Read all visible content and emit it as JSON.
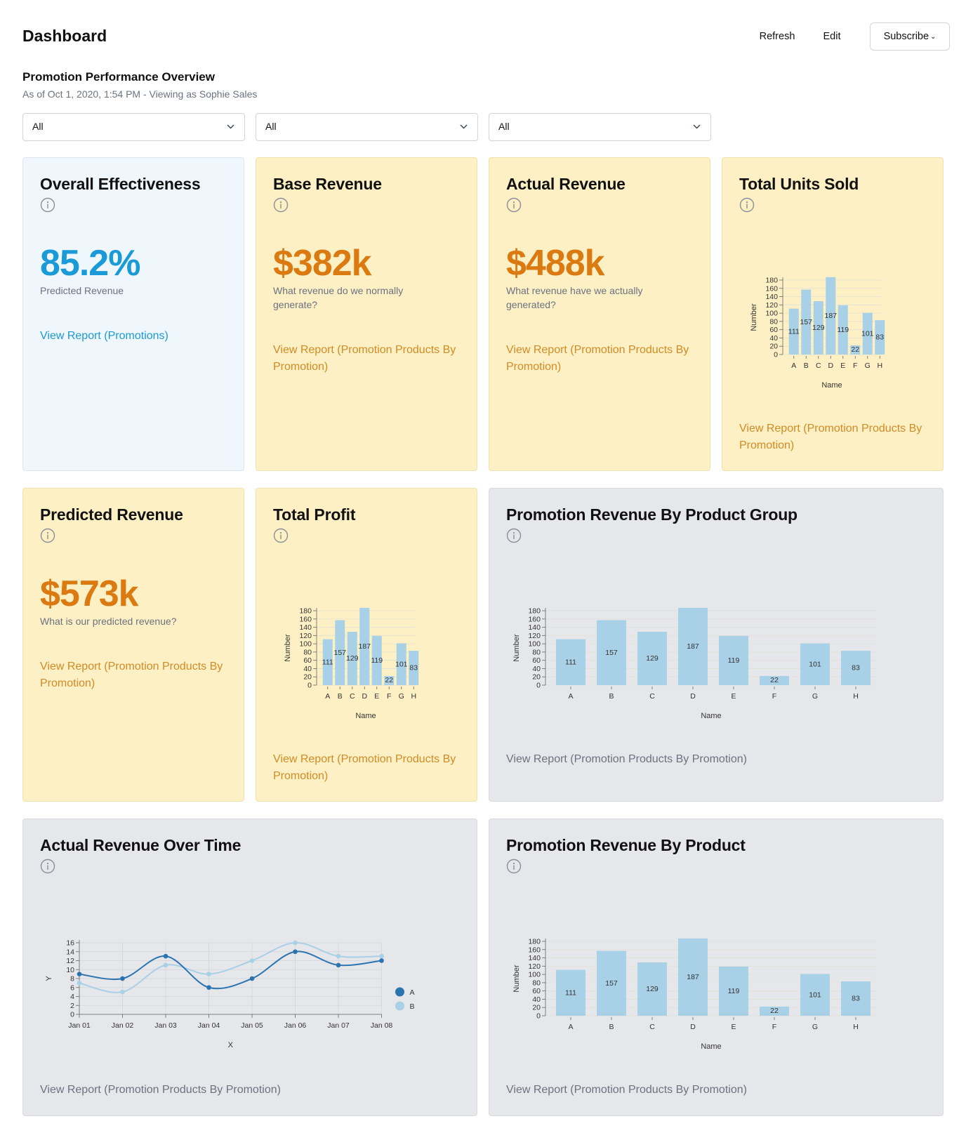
{
  "header": {
    "title": "Dashboard",
    "refresh_label": "Refresh",
    "edit_label": "Edit",
    "subscribe_label": "Subscribe"
  },
  "overview": {
    "title": "Promotion Performance Overview",
    "meta": "As of Oct 1, 2020, 1:54 PM - Viewing as Sophie Sales"
  },
  "filters": [
    {
      "value": "All"
    },
    {
      "value": "All"
    },
    {
      "value": "All"
    }
  ],
  "colors": {
    "card_blue": "#eff6fc",
    "card_yellow": "#fdf0c4",
    "card_gray": "#e6e7eb",
    "kpi_blue": "#1a9ad6",
    "kpi_orange": "#da7a11",
    "link_orange": "#d28b25",
    "bar": "#a8d0e6",
    "series_a": "#2c74b0",
    "series_b": "#a8d0e6"
  },
  "cards": {
    "overall_effectiveness": {
      "title": "Overall Effectiveness",
      "value": "85.2%",
      "desc": "Predicted Revenue",
      "link": "View Report (Promotions)"
    },
    "base_revenue": {
      "title": "Base Revenue",
      "value": "$382k",
      "desc": "What revenue do we normally generate?",
      "link": "View Report (Promotion Products By Promotion)"
    },
    "actual_revenue": {
      "title": "Actual Revenue",
      "value": "$488k",
      "desc": "What revenue have we actually generated?",
      "link": "View Report (Promotion Products By Promotion)"
    },
    "total_units_sold": {
      "title": "Total Units Sold",
      "link": "View Report (Promotion Products By Promotion)"
    },
    "predicted_revenue": {
      "title": "Predicted Revenue",
      "value": "$573k",
      "desc": "What is our predicted revenue?",
      "link": "View Report (Promotion Products By Promotion)"
    },
    "total_profit": {
      "title": "Total Profit",
      "link": "View Report (Promotion Products By Promotion)"
    },
    "revenue_by_product_group": {
      "title": "Promotion Revenue By Product Group",
      "link": "View Report (Promotion Products By Promotion)"
    },
    "revenue_over_time": {
      "title": "Actual Revenue Over Time",
      "link": "View Report (Promotion Products By Promotion)"
    },
    "revenue_by_product": {
      "title": "Promotion Revenue By Product",
      "link": "View Report (Promotion Products By Promotion)"
    }
  },
  "chart_data": [
    {
      "id": "units",
      "type": "bar",
      "categories": [
        "A",
        "B",
        "C",
        "D",
        "E",
        "F",
        "G",
        "H"
      ],
      "values": [
        111,
        157,
        129,
        187,
        119,
        22,
        101,
        83
      ],
      "xlabel": "Name",
      "ylabel": "Number",
      "yticks": [
        0,
        20,
        40,
        60,
        80,
        100,
        120,
        140,
        160,
        180
      ],
      "grid": true
    },
    {
      "id": "profit",
      "type": "bar",
      "categories": [
        "A",
        "B",
        "C",
        "D",
        "E",
        "F",
        "G",
        "H"
      ],
      "values": [
        111,
        157,
        129,
        187,
        119,
        22,
        101,
        83
      ],
      "xlabel": "Name",
      "ylabel": "Number",
      "yticks": [
        0,
        20,
        40,
        60,
        80,
        100,
        120,
        140,
        160,
        180
      ],
      "grid": true
    },
    {
      "id": "group",
      "type": "bar",
      "categories": [
        "A",
        "B",
        "C",
        "D",
        "E",
        "F",
        "G",
        "H"
      ],
      "values": [
        111,
        157,
        129,
        187,
        119,
        22,
        101,
        83
      ],
      "xlabel": "Name",
      "ylabel": "Number",
      "yticks": [
        0,
        20,
        40,
        60,
        80,
        100,
        120,
        140,
        160,
        180
      ],
      "grid": true
    },
    {
      "id": "overtime",
      "type": "line",
      "x": [
        "Jan 01",
        "Jan 02",
        "Jan 03",
        "Jan 04",
        "Jan 05",
        "Jan 06",
        "Jan 07",
        "Jan 08"
      ],
      "series": [
        {
          "name": "A",
          "values": [
            9,
            8,
            13,
            6,
            8,
            14,
            11,
            12
          ]
        },
        {
          "name": "B",
          "values": [
            7,
            5,
            11,
            9,
            12,
            16,
            13,
            13
          ]
        }
      ],
      "xlabel": "X",
      "ylabel": "Y",
      "yticks": [
        0,
        2,
        4,
        6,
        8,
        10,
        12,
        14,
        16
      ],
      "grid": true,
      "legend": "right"
    },
    {
      "id": "product",
      "type": "bar",
      "categories": [
        "A",
        "B",
        "C",
        "D",
        "E",
        "F",
        "G",
        "H"
      ],
      "values": [
        111,
        157,
        129,
        187,
        119,
        22,
        101,
        83
      ],
      "xlabel": "Name",
      "ylabel": "Number",
      "yticks": [
        0,
        20,
        40,
        60,
        80,
        100,
        120,
        140,
        160,
        180
      ],
      "grid": true
    }
  ]
}
